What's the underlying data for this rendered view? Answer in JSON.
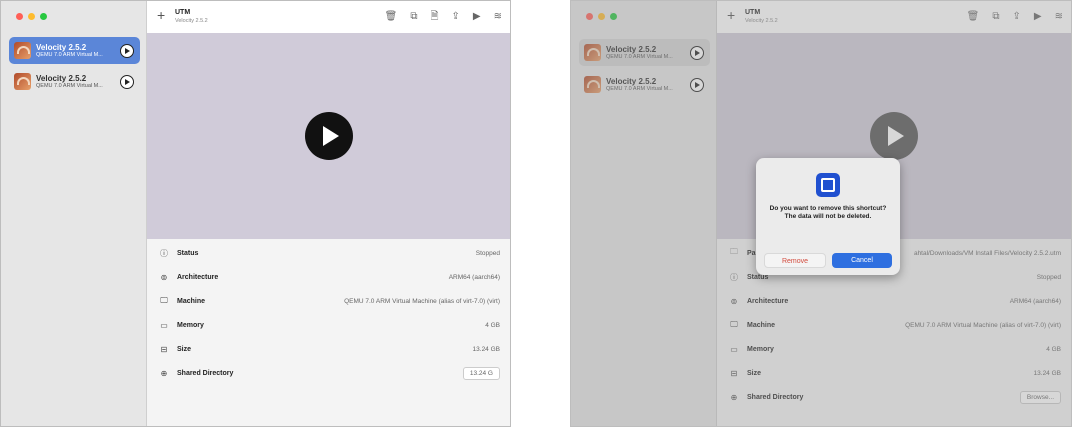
{
  "window1": {
    "app_title": "UTM",
    "app_subtitle": "Velocity 2.5.2",
    "vms": [
      {
        "name": "Velocity 2.5.2",
        "desc": "QEMU 7.0 ARM Virtual M...",
        "selected": true
      },
      {
        "name": "Velocity 2.5.2",
        "desc": "QEMU 7.0 ARM Virtual M...",
        "selected": false
      }
    ],
    "info": [
      {
        "icon": "info-icon",
        "label": "Status",
        "value": "Stopped"
      },
      {
        "icon": "chip-icon",
        "label": "Architecture",
        "value": "ARM64 (aarch64)"
      },
      {
        "icon": "monitor-icon",
        "label": "Machine",
        "value": "QEMU 7.0 ARM Virtual Machine (alias of virt-7.0) (virt)"
      },
      {
        "icon": "memory-icon",
        "label": "Memory",
        "value": "4 GB"
      },
      {
        "icon": "drive-icon",
        "label": "Size",
        "value": "13.24 GB"
      },
      {
        "icon": "shared-folder-icon",
        "label": "Shared Directory",
        "value": "13.24 G"
      }
    ]
  },
  "window2": {
    "app_title": "UTM",
    "app_subtitle": "Velocity 2.5.2",
    "vms": [
      {
        "name": "Velocity 2.5.2",
        "desc": "QEMU 7.0 ARM Virtual M...",
        "selected": false
      },
      {
        "name": "Velocity 2.5.2",
        "desc": "QEMU 7.0 ARM Virtual M...",
        "selected": false
      }
    ],
    "info": [
      {
        "icon": "folder-icon",
        "label": "Pa",
        "value": "ahtal/Downloads/VM Install Files/Velocity 2.5.2.utm"
      },
      {
        "icon": "info-icon",
        "label": "Status",
        "value": "Stopped"
      },
      {
        "icon": "chip-icon",
        "label": "Architecture",
        "value": "ARM64 (aarch64)"
      },
      {
        "icon": "monitor-icon",
        "label": "Machine",
        "value": "QEMU 7.0 ARM Virtual Machine (alias of virt-7.0) (virt)"
      },
      {
        "icon": "memory-icon",
        "label": "Memory",
        "value": "4 GB"
      },
      {
        "icon": "drive-icon",
        "label": "Size",
        "value": "13.24 GB"
      },
      {
        "icon": "shared-folder-icon",
        "label": "Shared Directory",
        "value": "Browse..."
      }
    ],
    "dialog": {
      "message": "Do you want to remove this shortcut? The data will not be deleted.",
      "remove_label": "Remove",
      "cancel_label": "Cancel"
    }
  },
  "icons": {
    "add": "+",
    "trash": "🗑",
    "clone": "⧉",
    "file": "🗎",
    "share": "⇪",
    "play": "▶",
    "settings": "≋",
    "info": "ⓘ",
    "chip": "⊚",
    "monitor": "🖵",
    "memory": "▭",
    "drive": "⊟",
    "shared": "⊕",
    "folder": "🗀"
  },
  "colors": {
    "selection": "#5b86d8",
    "preview_bg": "#d0cbd9",
    "cancel_button": "#2e6fe0",
    "remove_text": "#d24b3d",
    "light_red": "#ff5f57",
    "light_yellow": "#febc2e",
    "light_green": "#28c840"
  }
}
